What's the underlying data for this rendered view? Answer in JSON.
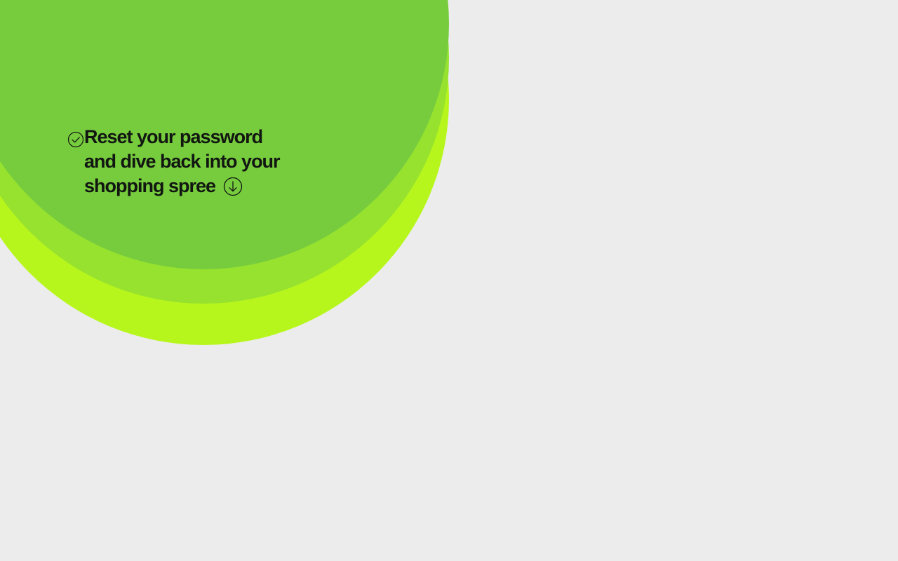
{
  "hero": {
    "headline_lines": [
      "Reset your password",
      "and dive back into your",
      "shopping spree"
    ],
    "leading_icon": "check-circle-icon",
    "trailing_icon": "arrow-down-circle-icon"
  },
  "colors": {
    "background": "#ececec",
    "circle_outer": "#b7f61d",
    "circle_middle": "#96e22f",
    "circle_inner": "#77cc3e",
    "text": "#111611"
  }
}
